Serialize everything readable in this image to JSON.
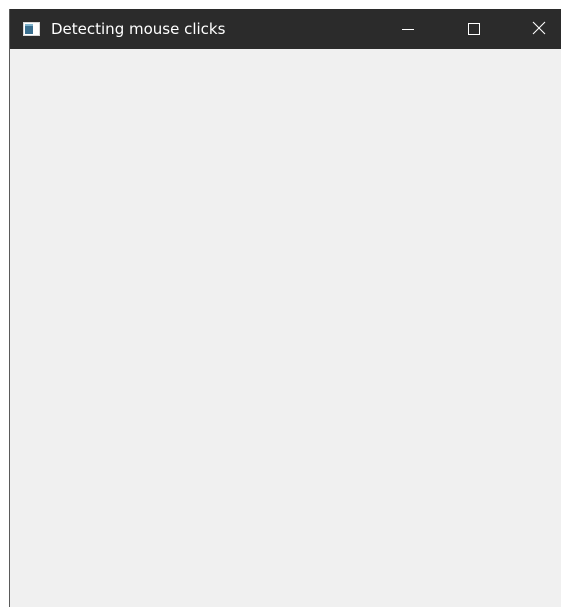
{
  "window": {
    "title": "Detecting mouse clicks",
    "icons": {
      "app": "app-window-icon",
      "minimize": "minimize-icon",
      "maximize": "maximize-icon",
      "close": "close-icon"
    },
    "colors": {
      "titlebar": "#2b2b2b",
      "title_text": "#ffffff",
      "client_bg": "#f0f0f0"
    }
  }
}
